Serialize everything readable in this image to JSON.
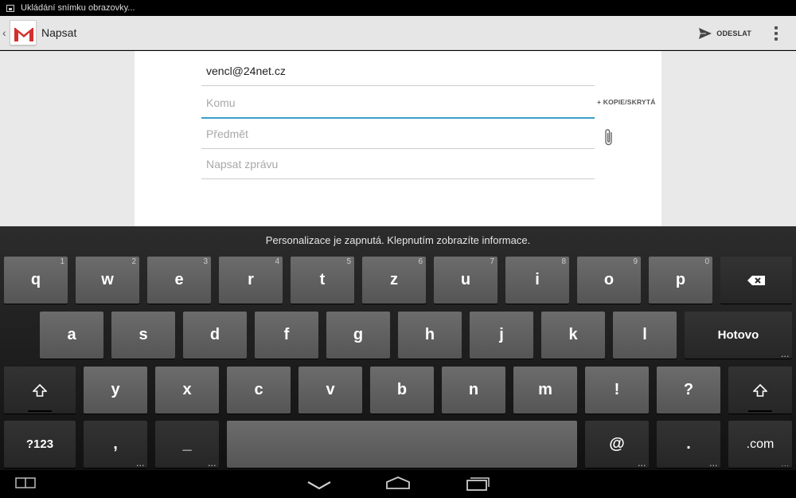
{
  "status_bar": {
    "text": "Ukládání snímku obrazovky..."
  },
  "action_bar": {
    "title": "Napsat",
    "send_label": "ODESLAT"
  },
  "compose": {
    "from": "vencl@24net.cz",
    "to_placeholder": "Komu",
    "cc_bcc_label": "+ KOPIE/SKRYTÁ",
    "subject_placeholder": "Předmět",
    "body_placeholder": "Napsat zprávu"
  },
  "keyboard": {
    "hint": "Personalizace je zapnutá. Klepnutím zobrazíte informace.",
    "row1": [
      {
        "label": "q",
        "num": "1"
      },
      {
        "label": "w",
        "num": "2"
      },
      {
        "label": "e",
        "num": "3"
      },
      {
        "label": "r",
        "num": "4"
      },
      {
        "label": "t",
        "num": "5"
      },
      {
        "label": "z",
        "num": "6"
      },
      {
        "label": "u",
        "num": "7"
      },
      {
        "label": "i",
        "num": "8"
      },
      {
        "label": "o",
        "num": "9"
      },
      {
        "label": "p",
        "num": "0"
      }
    ],
    "row2": [
      "a",
      "s",
      "d",
      "f",
      "g",
      "h",
      "j",
      "k",
      "l"
    ],
    "done_label": "Hotovo",
    "row3": [
      "y",
      "x",
      "c",
      "v",
      "b",
      "n",
      "m",
      "!",
      "?"
    ],
    "symbols_label": "?123",
    "comma_label": ",",
    "dash_label": "_",
    "at_label": "@",
    "period_label": ".",
    "com_label": ".com"
  },
  "icons": {
    "backspace": "backspace-icon",
    "shift": "shift-icon",
    "send": "send-icon",
    "attach": "paperclip-icon",
    "overflow": "overflow-menu-icon"
  }
}
